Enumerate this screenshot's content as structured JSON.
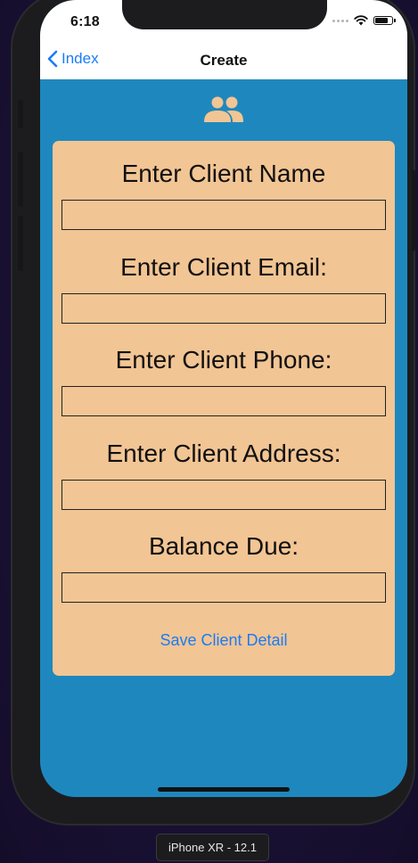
{
  "status_bar": {
    "time": "6:18"
  },
  "nav": {
    "back_label": "Index",
    "title": "Create"
  },
  "header_icon": "people-icon",
  "form": {
    "fields": [
      {
        "label": "Enter Client Name",
        "value": "",
        "placeholder": ""
      },
      {
        "label": "Enter Client Email:",
        "value": "",
        "placeholder": ""
      },
      {
        "label": "Enter Client Phone:",
        "value": "",
        "placeholder": ""
      },
      {
        "label": "Enter Client Address:",
        "value": "",
        "placeholder": ""
      },
      {
        "label": "Balance Due:",
        "value": "",
        "placeholder": ""
      }
    ],
    "save_label": "Save Client Detail"
  },
  "simulator": {
    "device_label": "iPhone XR - 12.1"
  },
  "colors": {
    "screen_background": "#1e88be",
    "card_background": "#f2c594",
    "accent": "#1a7cf5",
    "icon_color": "#f2c594"
  },
  "battery_level": 0.85
}
